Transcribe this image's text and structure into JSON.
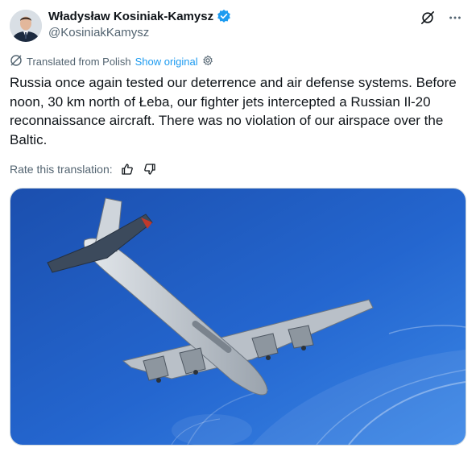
{
  "author": {
    "name": "Władysław Kosiniak-Kamysz",
    "handle": "@KosiniakKamysz",
    "verified": true,
    "avatar_icon": "person-avatar"
  },
  "translation": {
    "label": "Translated from Polish",
    "show_original": "Show original",
    "icon": "translate-icon",
    "settings_icon": "gear-icon"
  },
  "tweet": {
    "text": "Russia once again tested our deterrence and air defense systems. Before noon, 30 km north of Łeba, our fighter jets intercepted a Russian Il-20 reconnaissance aircraft. There was no violation of our airspace over the Baltic."
  },
  "rating": {
    "label": "Rate this translation:"
  },
  "media": {
    "type": "photo",
    "sky_color": "#1f5fc4",
    "aircraft_color": "#c8cdd3"
  },
  "colors": {
    "accent": "#1d9bf0",
    "muted": "#536471",
    "text": "#0f1419"
  }
}
